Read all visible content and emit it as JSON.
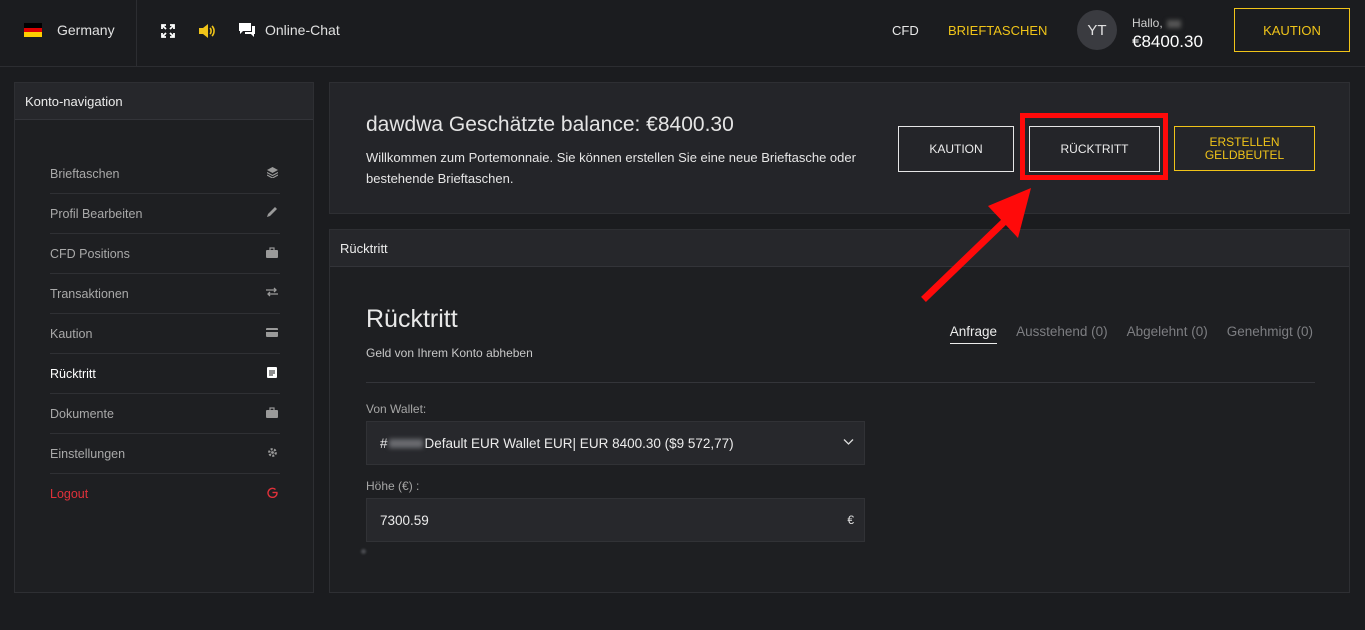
{
  "topbar": {
    "country": "Germany",
    "chat": "Online-Chat",
    "nav_cfd": "CFD",
    "nav_wallets": "BRIEFTASCHEN",
    "avatar_initials": "YT",
    "greeting": "Hallo,",
    "balance": "€8400.30",
    "deposit_button": "KAUTION",
    "accent_color": "#f0c419"
  },
  "sidebar": {
    "title": "Konto-navigation",
    "items": [
      {
        "label": "Brieftaschen",
        "icon": "layers-icon"
      },
      {
        "label": "Profil Bearbeiten",
        "icon": "pencil-icon"
      },
      {
        "label": "CFD Positions",
        "icon": "briefcase-icon"
      },
      {
        "label": "Transaktionen",
        "icon": "transfer-icon"
      },
      {
        "label": "Kaution",
        "icon": "card-icon"
      },
      {
        "label": "Rücktritt",
        "icon": "document-icon"
      },
      {
        "label": "Dokumente",
        "icon": "briefcase-icon"
      },
      {
        "label": "Einstellungen",
        "icon": "gear-icon"
      },
      {
        "label": "Logout",
        "icon": "power-icon"
      }
    ],
    "active_item": "Rücktritt",
    "logout_color": "#e0313a"
  },
  "wallet_panel": {
    "title": "dawdwa Geschätzte balance: €8400.30",
    "description": "Willkommen zum Portemonnaie. Sie können erstellen Sie eine neue Brieftasche oder bestehende Brieftaschen.",
    "deposit_button": "KAUTION",
    "withdraw_button": "RÜCKTRITT",
    "create_button": "ERSTELLEN GELDBEUTEL"
  },
  "withdraw_panel": {
    "header": "Rücktritt",
    "title": "Rücktritt",
    "subtitle": "Geld von Ihrem Konto abheben",
    "tabs": [
      {
        "label": "Anfrage",
        "active": true
      },
      {
        "label": "Ausstehend (0)",
        "active": false
      },
      {
        "label": "Abgelehnt (0)",
        "active": false
      },
      {
        "label": "Genehmigt (0)",
        "active": false
      }
    ],
    "wallet_label": "Von Wallet:",
    "wallet_prefix": "#",
    "wallet_value": "Default EUR Wallet EUR| EUR 8400.30 ($9 572,77)",
    "amount_label": "Höhe (€) :",
    "amount_value": "7300.59",
    "amount_currency": "€"
  },
  "annotation": {
    "highlight_color": "#ff0a0a"
  }
}
